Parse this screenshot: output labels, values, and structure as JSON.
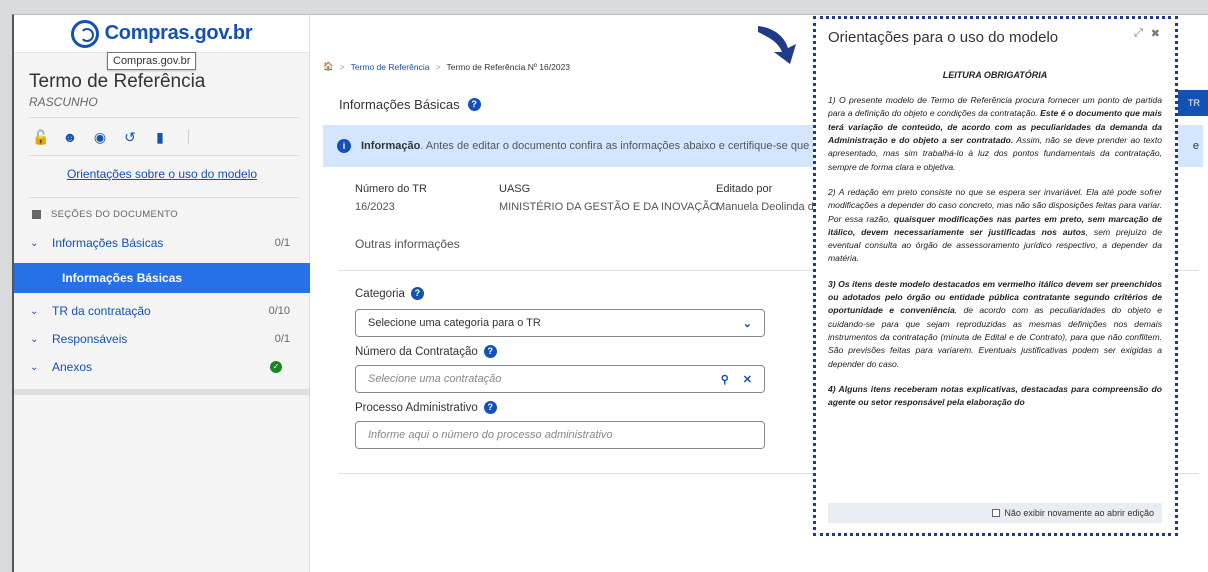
{
  "brand": {
    "logo_text": "Compras.gov.br",
    "tooltip": "Compras.gov.br"
  },
  "sidebar": {
    "title": "Termo de Referência",
    "status": "RASCUNHO",
    "toolbar_icons": [
      "lock-icon",
      "users-icon",
      "eye-icon",
      "history-icon",
      "file-icon"
    ],
    "guide_link": "Orientações sobre o uso do modelo",
    "sections_header": "SEÇÕES DO DOCUMENTO",
    "items": [
      {
        "label": "Informações Básicas",
        "count": "0/1"
      },
      {
        "label": "Informações Básicas",
        "count": ""
      },
      {
        "label": "TR da contratação",
        "count": "0/10"
      },
      {
        "label": "Responsáveis",
        "count": "0/1"
      },
      {
        "label": "Anexos",
        "count": ""
      }
    ]
  },
  "breadcrumb": {
    "items": [
      "Termo de Referência",
      "Termo de Referência Nº 16/2023"
    ]
  },
  "main": {
    "title": "Informações Básicas",
    "info_bold": "Informação",
    "info_text": ". Antes de editar o documento confira as informações abaixo e certifique-se que esta",
    "columns": [
      {
        "label": "Número do TR",
        "value": "16/2023"
      },
      {
        "label": "UASG",
        "value": "MINISTÉRIO DA GESTÃO E DA INOVAÇÃO"
      },
      {
        "label": "Editado por",
        "value": "Manuela Deolinda do"
      }
    ],
    "outras": "Outras informações",
    "categoria_label": "Categoria",
    "categoria_value": "Selecione uma categoria para o TR",
    "contratacao_label": "Número da Contratação",
    "contratacao_placeholder": "Selecione uma contratação",
    "processo_label": "Processo Administrativo",
    "processo_placeholder": "Informe aqui o número do processo administrativo",
    "tr_button": "TR",
    "right_edge_letter": "e"
  },
  "modal": {
    "title": "Orientações para o uso do modelo",
    "heading": "LEITURA OBRIGATÓRIA",
    "p1_a": "1) O presente modelo de Termo de Referência procura fornecer um ponto de partida para a definição do objeto e condições da contratação. ",
    "p1_b": "Este é o documento que mais terá variação de conteúdo, de acordo com as peculiaridades da demanda da Administração e do objeto a ser contratado.",
    "p1_c": " Assim, não se deve prender ao texto apresentado, mas sim trabalhá-lo à luz dos pontos fundamentais da contratação, sempre de forma clara e objetiva.",
    "p2_a": "2) A redação em preto consiste no que se espera ser invariável. Ela até pode sofrer modificações a depender do caso concreto, mas não são disposições feitas para variar. Por essa razão, ",
    "p2_b": "quaisquer modificações nas partes em preto, sem marcação de itálico, devem necessariamente ser justificadas nos autos",
    "p2_c": ", sem prejuízo de eventual consulta ao órgão de assessoramento jurídico respectivo, a depender da matéria.",
    "p3_a": "3) Os itens deste modelo destacados em vermelho itálico devem ser preenchidos ou adotados pelo órgão ou entidade pública contratante segundo critérios de oportunidade e conveniência",
    "p3_b": ", de acordo com as peculiaridades do objeto e cuidando-se para que sejam reproduzidas as mesmas definições nos demais instrumentos da contratação (minuta de Edital e de Contrato), para que não conflitem. São previsões feitas para variarem. Eventuais justificativas podem ser exigidas a depender do caso.",
    "p4_a": "4) Alguns itens receberam notas explicativas, destacadas para compreensão do agente ou setor responsável pela elaboração do",
    "footer": "Não exibir novamente ao abrir edição"
  }
}
